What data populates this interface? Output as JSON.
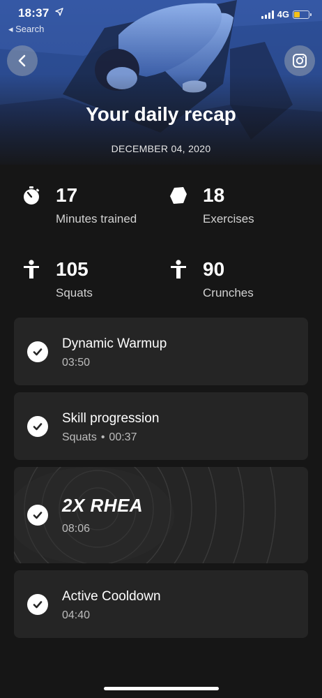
{
  "status_bar": {
    "time": "18:37",
    "back_app": "◂ Search",
    "network": "4G",
    "battery_level": 0.4
  },
  "header": {
    "title": "Your daily recap",
    "date": "DECEMBER 04, 2020"
  },
  "stats": [
    {
      "value": "17",
      "label": "Minutes trained",
      "icon": "stopwatch-icon"
    },
    {
      "value": "18",
      "label": "Exercises",
      "icon": "polygon-icon"
    },
    {
      "value": "105",
      "label": "Squats",
      "icon": "person-icon"
    },
    {
      "value": "90",
      "label": "Crunches",
      "icon": "person-icon"
    }
  ],
  "sessions": [
    {
      "title": "Dynamic Warmup",
      "duration": "03:50",
      "completed": true
    },
    {
      "title": "Skill progression",
      "detail": "Squats",
      "separator": "•",
      "duration": "00:37",
      "completed": true
    },
    {
      "title": "2X RHEA",
      "duration": "08:06",
      "completed": true
    },
    {
      "title": "Active Cooldown",
      "duration": "04:40",
      "completed": true
    }
  ],
  "colors": {
    "background": "#161616",
    "card": "#252525",
    "hero_blue": "#2b4b8e",
    "battery": "#f5c118"
  }
}
